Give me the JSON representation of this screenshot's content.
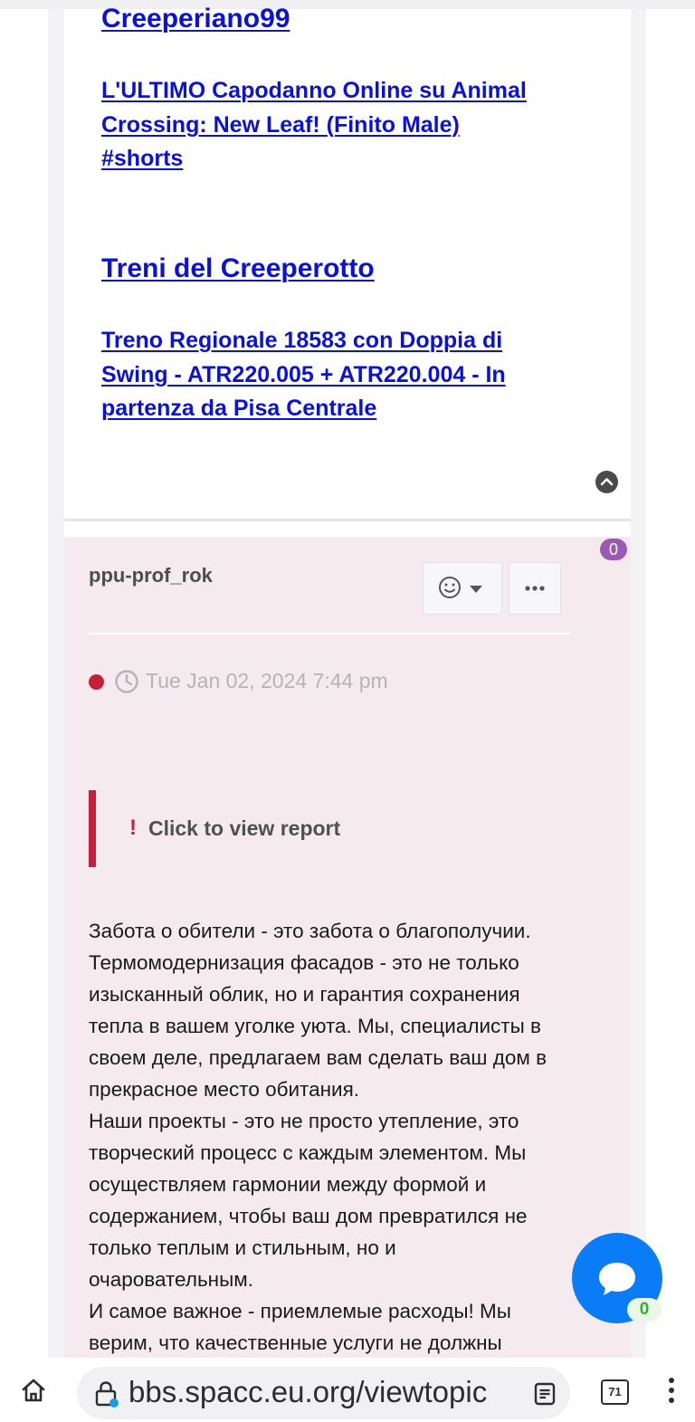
{
  "top_card": {
    "channel1": "Creeperiano99",
    "video1_lines": [
      "L'ULTIMO Capodanno Online su Animal",
      "Crossing: New Leaf! (Finito Male)",
      "#shorts"
    ],
    "channel2": "Treni del Creeperotto",
    "video2_lines": [
      "Treno Regionale 18583 con Doppia di",
      "Swing - ATR220.005 + ATR220.004 - In",
      "partenza da Pisa Centrale"
    ],
    "back_to_top_icon": "chevron-up-icon"
  },
  "post": {
    "reactions_badge": "0",
    "author": "ppu-prof_rok",
    "react_icon": "smiley-icon",
    "more_label": "•••",
    "date": "Tue Jan 02, 2024 7:44 pm",
    "report_mark": "!",
    "report_text": "Click to view report",
    "body_lines": [
      "Забота о обители - это забота о благополучии.",
      "Термомодернизация фасадов - это не только",
      "изысканный облик, но и гарантия сохранения",
      "тепла в вашем уголке уюта. Мы, специалисты в",
      "своем деле, предлагаем вам сделать ваш дом в",
      "прекрасное место обитания.",
      "Наши проекты - это не просто утепление, это",
      "творческий процесс с каждым элементом. Мы",
      "осуществляем гармонии между формой и",
      "содержанием, чтобы ваш дом превратился не",
      "только теплым и стильным, но и",
      "очаровательным.",
      "И самое важное - приемлемые расходы! Мы",
      "верим, что качественные услуги не должны"
    ]
  },
  "chat": {
    "count": "0"
  },
  "browser": {
    "url": "bbs.spacc.eu.org/viewtopic",
    "tab_count": "71"
  },
  "colors": {
    "link": "#0a11d9",
    "post_bg": "#f5eaee",
    "accent_red": "#c5203b",
    "badge_purple": "#9b59b6",
    "chat_blue": "#0a7cf5"
  }
}
